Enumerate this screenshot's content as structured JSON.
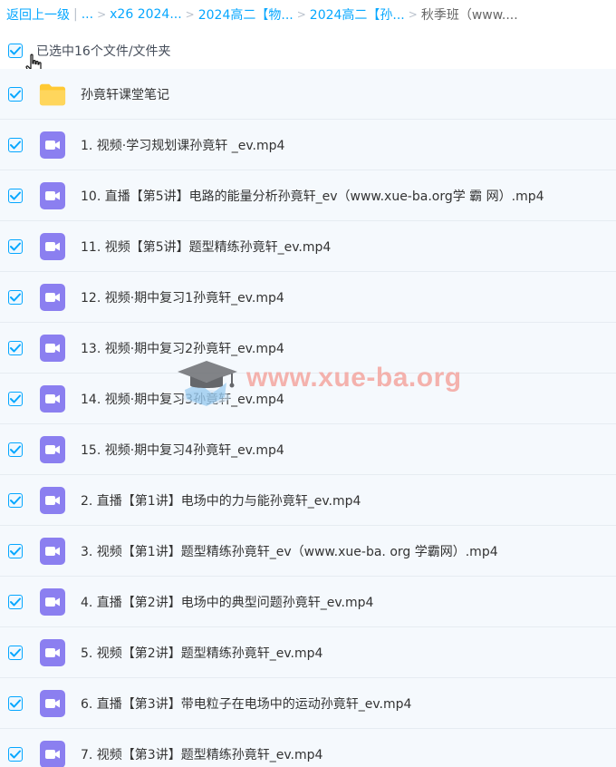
{
  "breadcrumb": {
    "back_label": "返回上一级",
    "ellipsis": "...",
    "items": [
      "x26 2024...",
      "2024高二【物...",
      "2024高二【孙..."
    ],
    "current": "秋季班（www...."
  },
  "selection": {
    "label": "已选中16个文件/文件夹",
    "checked": true
  },
  "files": [
    {
      "name": "孙竟轩课堂笔记",
      "type": "folder-icon"
    },
    {
      "name": "1. 视频·学习规划课孙竟轩 _ev.mp4",
      "type": "video-file-icon"
    },
    {
      "name": "10. 直播【第5讲】电路的能量分析孙竟轩_ev（www.xue-ba.org学 霸 网）.mp4",
      "type": "video-file-icon"
    },
    {
      "name": "11. 视频【第5讲】题型精练孙竟轩_ev.mp4",
      "type": "video-file-icon"
    },
    {
      "name": "12. 视频·期中复习1孙竟轩_ev.mp4",
      "type": "video-file-icon"
    },
    {
      "name": "13. 视频·期中复习2孙竟轩_ev.mp4",
      "type": "video-file-icon"
    },
    {
      "name": "14. 视频·期中复习3孙竟轩_ev.mp4",
      "type": "video-file-icon"
    },
    {
      "name": "15. 视频·期中复习4孙竟轩_ev.mp4",
      "type": "video-file-icon"
    },
    {
      "name": "2. 直播【第1讲】电场中的力与能孙竟轩_ev.mp4",
      "type": "video-file-icon"
    },
    {
      "name": "3. 视频【第1讲】题型精练孙竟轩_ev（www.xue-ba. org 学霸网）.mp4",
      "type": "video-file-icon"
    },
    {
      "name": "4. 直播【第2讲】电场中的典型问题孙竟轩_ev.mp4",
      "type": "video-file-icon"
    },
    {
      "name": "5. 视频【第2讲】题型精练孙竟轩_ev.mp4",
      "type": "video-file-icon"
    },
    {
      "name": "6. 直播【第3讲】带电粒子在电场中的运动孙竟轩_ev.mp4",
      "type": "video-file-icon"
    },
    {
      "name": "7. 视频【第3讲】题型精练孙竟轩_ev.mp4",
      "type": "video-file-icon"
    }
  ],
  "watermark": {
    "text": "www.xue-ba.org"
  },
  "colors": {
    "accent": "#06a7ff",
    "folder": "#ffc933",
    "video_icon": "#8b7ff0",
    "row_bg": "#f5f9fd",
    "watermark": "#f4a6a0"
  }
}
